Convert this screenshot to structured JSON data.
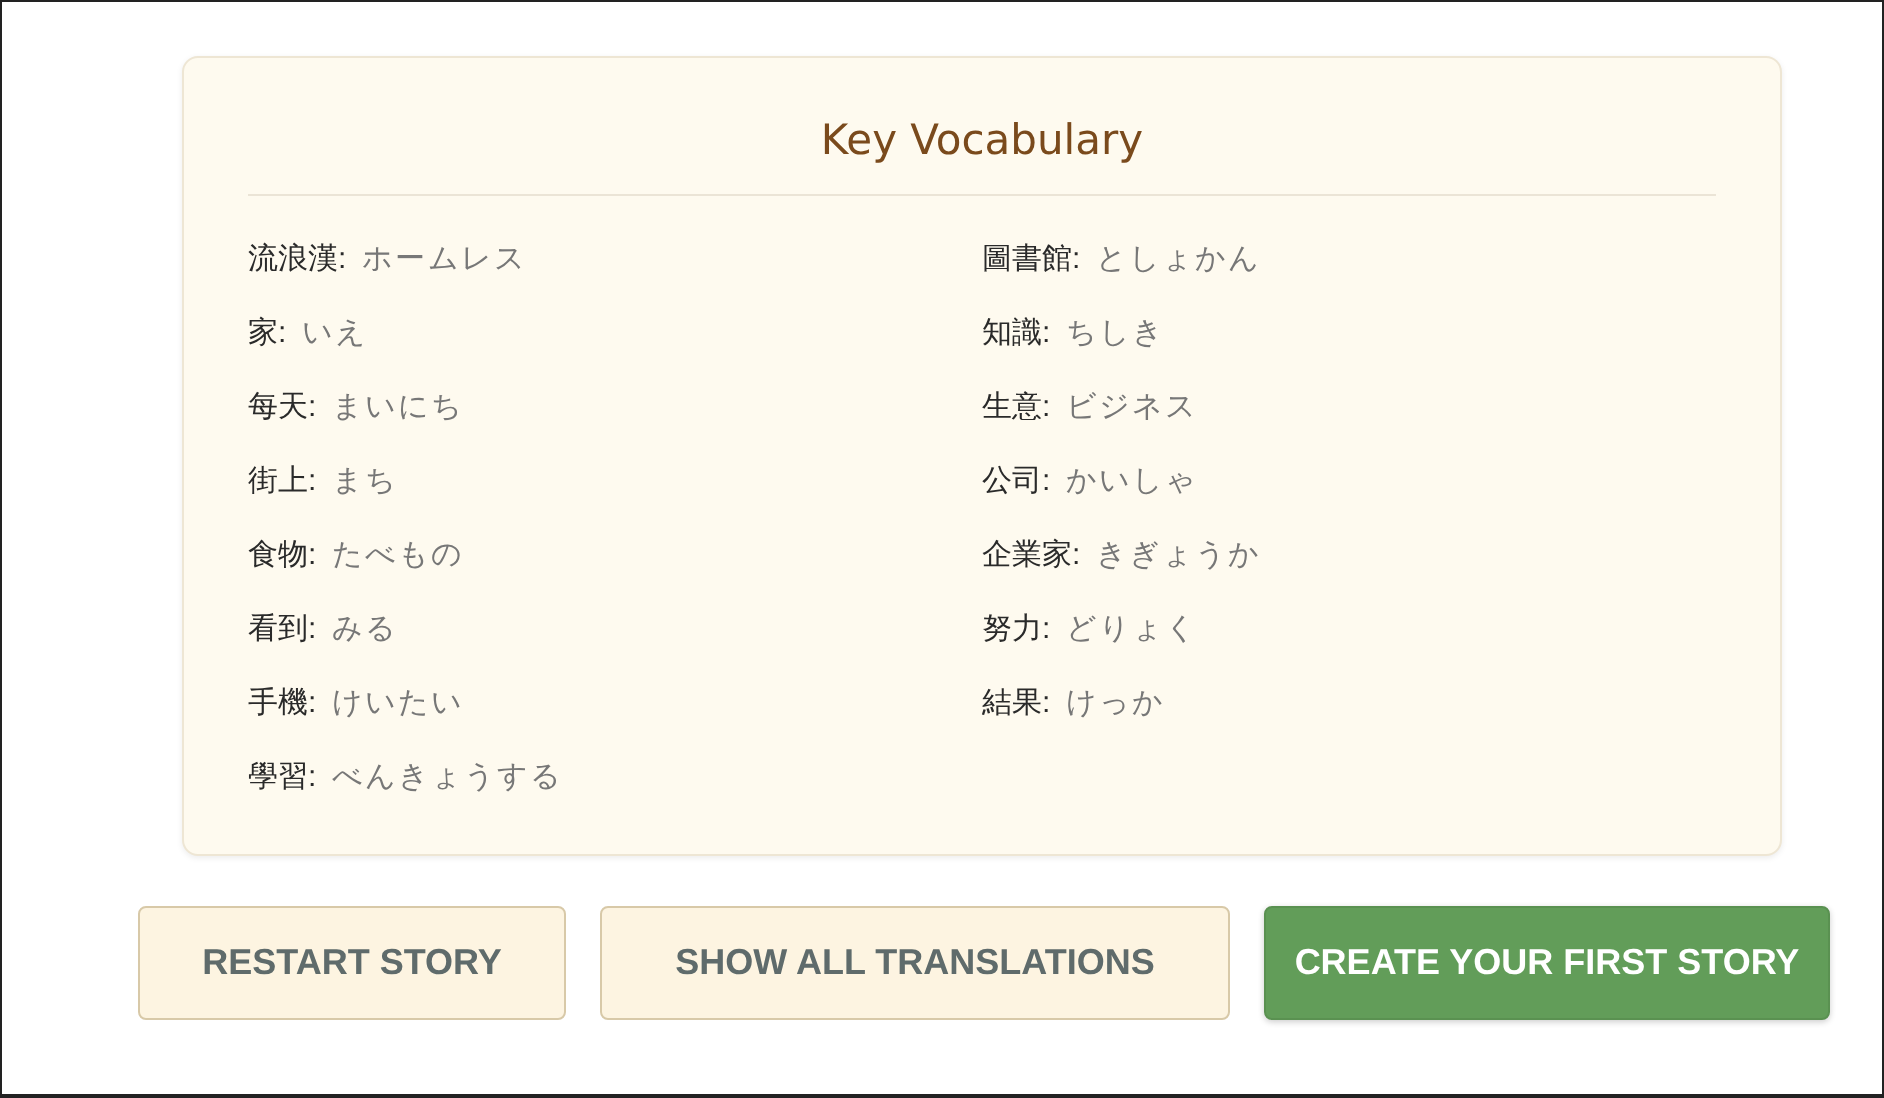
{
  "vocabulary": {
    "title": "Key Vocabulary",
    "columns": [
      [
        {
          "term": "流浪漢:",
          "reading": "ホームレス"
        },
        {
          "term": "家:",
          "reading": "いえ"
        },
        {
          "term": "每天:",
          "reading": "まいにち"
        },
        {
          "term": "街上:",
          "reading": "まち"
        },
        {
          "term": "食物:",
          "reading": "たべもの"
        },
        {
          "term": "看到:",
          "reading": "みる"
        },
        {
          "term": "手機:",
          "reading": "けいたい"
        },
        {
          "term": "學習:",
          "reading": "べんきょうする"
        }
      ],
      [
        {
          "term": "圖書館:",
          "reading": "としょかん"
        },
        {
          "term": "知識:",
          "reading": "ちしき"
        },
        {
          "term": "生意:",
          "reading": "ビジネス"
        },
        {
          "term": "公司:",
          "reading": "かいしゃ"
        },
        {
          "term": "企業家:",
          "reading": "きぎょうか"
        },
        {
          "term": "努力:",
          "reading": "どりょく"
        },
        {
          "term": "結果:",
          "reading": "けっか"
        }
      ]
    ]
  },
  "buttons": [
    {
      "label": "RESTART STORY",
      "kind": "secondary"
    },
    {
      "label": "SHOW ALL TRANSLATIONS",
      "kind": "secondary"
    },
    {
      "label": "CREATE YOUR FIRST STORY",
      "kind": "primary"
    }
  ]
}
